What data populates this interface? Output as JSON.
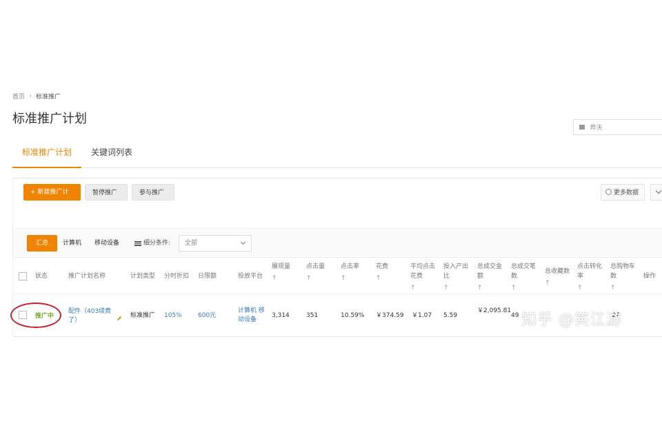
{
  "breadcrumb": {
    "home": "首页",
    "current": "标准推广"
  },
  "page_title": "标准推广计划",
  "date_picker": {
    "value": "昨天"
  },
  "tabs": [
    {
      "label": "标准推广计划",
      "active": true
    },
    {
      "label": "关键词列表",
      "active": false
    }
  ],
  "toolbar": {
    "new_plan": "+ 新建推广计划",
    "pause": "暂停推广",
    "join": "参与推广",
    "more_data": "更多数据"
  },
  "filters": {
    "all": "汇总",
    "pc": "计算机",
    "mobile": "移动设备",
    "breakdown_label": "细分条件:",
    "breakdown_value": "全部"
  },
  "table": {
    "columns": [
      "状态",
      "推广计划名称",
      "计划类型",
      "分时折扣",
      "日限额",
      "投放平台",
      "展现量",
      "点击量",
      "点击率",
      "花费",
      "平均点击花费",
      "投入产出比",
      "总成交金额",
      "总成交笔数",
      "总收藏数",
      "点击转化率",
      "总购物车数",
      "操作"
    ],
    "sort_arrow": "↑",
    "rows": [
      {
        "status": "推广中",
        "name": "配件（403续费了）",
        "type": "标准推广",
        "discount": "105%",
        "daily_limit": "600元",
        "platform": "计算机 移动设备",
        "impressions": "3,314",
        "clicks": "351",
        "ctr": "10.59%",
        "cost": "￥374.59",
        "avg_cpc": "￥1.07",
        "roi": "5.59",
        "total_amount": "￥2,095.81",
        "total_orders": "49",
        "cart": "27"
      }
    ]
  },
  "watermark": "知乎 @笑江游",
  "colors": {
    "accent": "#f08300",
    "link": "#3a7ab8",
    "status_active": "#7aa62e",
    "annotation_ring": "#c8222a"
  }
}
